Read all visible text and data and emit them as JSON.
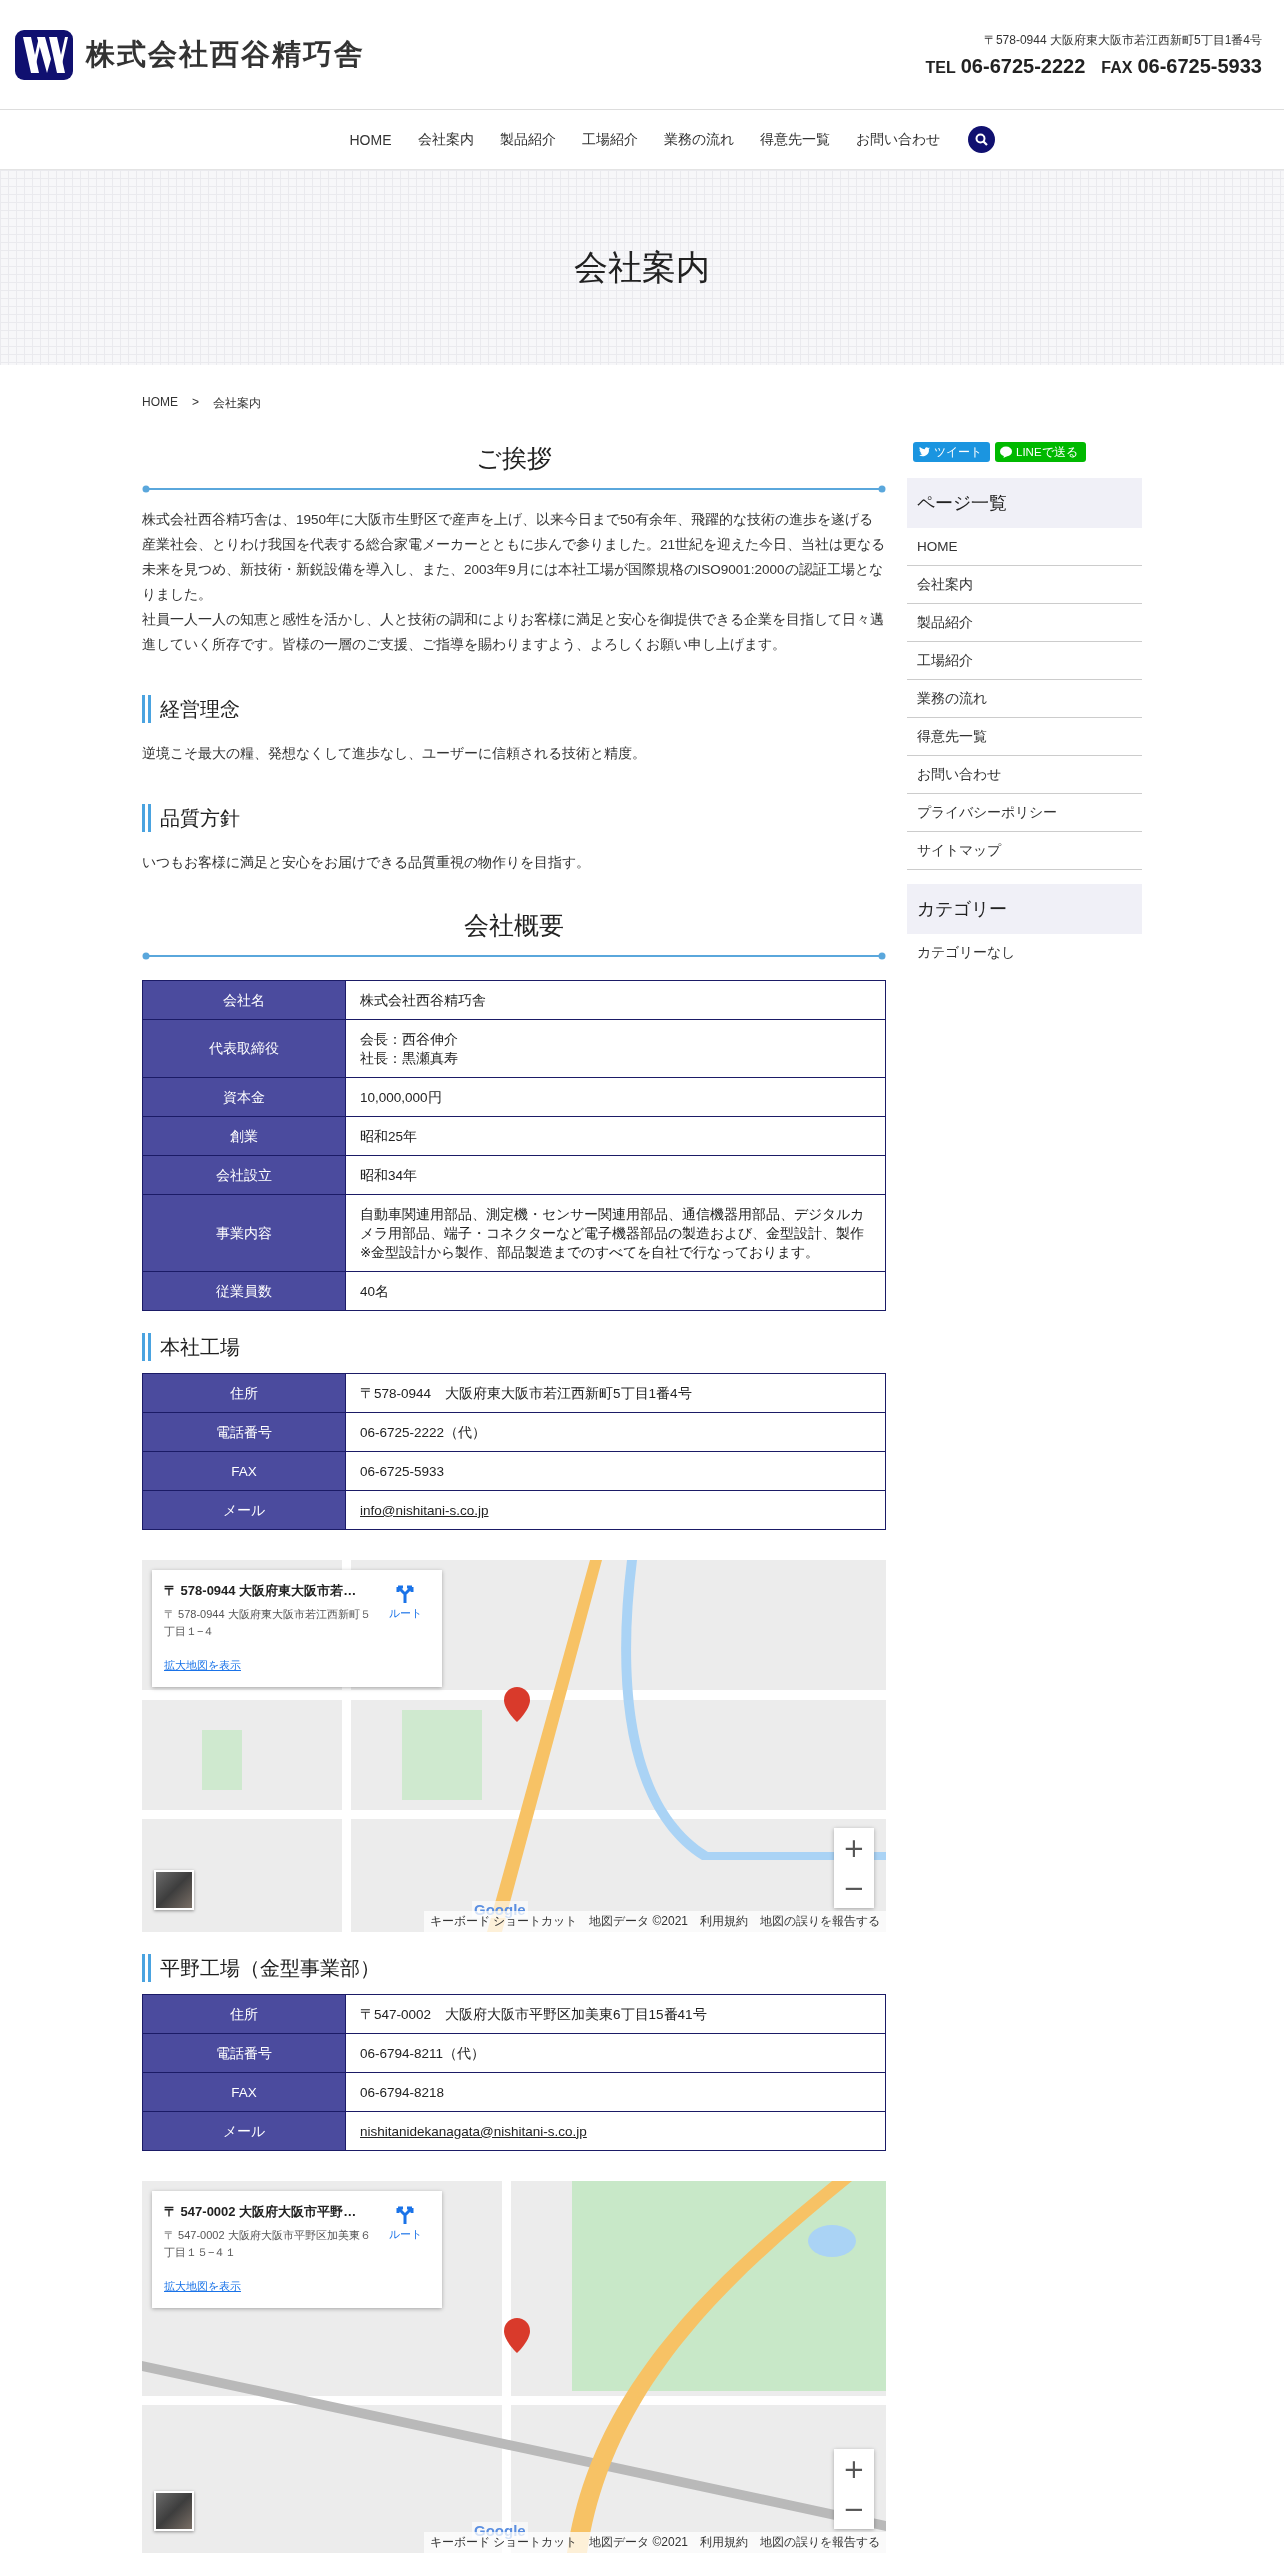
{
  "header": {
    "company_name": "株式会社西谷精巧舎",
    "address": "〒578-0944 大阪府東大阪市若江西新町5丁目1番4号",
    "tel_label": "TEL",
    "tel": "06-6725-2222",
    "fax_label": "FAX",
    "fax": "06-6725-5933"
  },
  "nav": [
    "HOME",
    "会社案内",
    "製品紹介",
    "工場紹介",
    "業務の流れ",
    "得意先一覧",
    "お問い合わせ"
  ],
  "hero_title": "会社案内",
  "breadcrumb": {
    "items": [
      "HOME",
      "会社案内"
    ],
    "separator": ">"
  },
  "main": [
    {
      "kind": "heading",
      "text": "ご挨拶"
    },
    {
      "kind": "text",
      "paragraphs": [
        "株式会社西谷精巧舎は、1950年に大阪市生野区で産声を上げ、以来今日まで50有余年、飛躍的な技術の進歩を遂げる産業社会、とりわけ我国を代表する総合家電メーカーとともに歩んで参りました。21世紀を迎えた今日、当社は更なる未来を見つめ、新技術・新鋭設備を導入し、また、2003年9月には本社工場が国際規格のISO9001:2000の認証工場となりました。",
        "社員一人一人の知恵と感性を活かし、人と技術の調和によりお客様に満足と安心を御提供できる企業を目指して日々邁進していく所存です。皆様の一層のご支援、ご指導を賜わりますよう、よろしくお願い申し上げます。"
      ]
    },
    {
      "kind": "subheading",
      "text": "経営理念"
    },
    {
      "kind": "text",
      "paragraphs": [
        "逆境こそ最大の糧、発想なくして進歩なし、ユーザーに信頼される技術と精度。"
      ]
    },
    {
      "kind": "subheading",
      "text": "品質方針"
    },
    {
      "kind": "text",
      "paragraphs": [
        "いつもお客様に満足と安心をお届けできる品質重視の物作りを目指す。"
      ]
    },
    {
      "kind": "heading",
      "text": "会社概要"
    },
    {
      "kind": "table",
      "rows": [
        {
          "label": "会社名",
          "value": "株式会社西谷精巧舎",
          "kind": "text"
        },
        {
          "label": "代表取締役",
          "value": "会長：西谷伸介",
          "value_2": "社長：黒瀬真寿",
          "kind": "text"
        },
        {
          "label": "資本金",
          "value": "10,000,000円",
          "kind": "text"
        },
        {
          "label": "創業",
          "value": "昭和25年",
          "kind": "text"
        },
        {
          "label": "会社設立",
          "value": "昭和34年",
          "kind": "text"
        },
        {
          "label": "事業内容",
          "value": "自動車関連用部品、測定機・センサー関連用部品、通信機器用部品、デジタルカメラ用部品、端子・コネクターなど電子機器部品の製造および、金型設計、製作",
          "value_2": "※金型設計から製作、部品製造までのすべてを自社で行なっております。",
          "kind": "text"
        },
        {
          "label": "従業員数",
          "value": "40名",
          "kind": "text"
        }
      ]
    },
    {
      "kind": "subheading",
      "text": "本社工場"
    },
    {
      "kind": "table",
      "rows": [
        {
          "label": "住所",
          "value": "〒578-0944　大阪府東大阪市若江西新町5丁目1番4号",
          "kind": "text"
        },
        {
          "label": "電話番号",
          "value": "06-6725-2222（代）",
          "kind": "text"
        },
        {
          "label": "FAX",
          "value": "06-6725-5933",
          "kind": "text"
        },
        {
          "label": "メール",
          "value": "info@nishitani-s.co.jp",
          "kind": "email"
        }
      ]
    },
    {
      "kind": "map",
      "card": {
        "title": "〒 578-0944 大阪府東大阪市若…",
        "address": "〒 578-0944 大阪府東大阪市若江西新町５丁目１−４",
        "route": "ルート",
        "link": "拡大地図を表示"
      },
      "zoom_in": "+",
      "zoom_out": "−",
      "logo": "Google",
      "attribution": [
        "キーボード ショートカット",
        "地図データ ©2021",
        "利用規約",
        "地図の誤りを報告する"
      ]
    },
    {
      "kind": "subheading",
      "text": "平野工場（金型事業部）"
    },
    {
      "kind": "table",
      "rows": [
        {
          "label": "住所",
          "value": "〒547-0002　大阪府大阪市平野区加美東6丁目15番41号",
          "kind": "text"
        },
        {
          "label": "電話番号",
          "value": "06-6794-8211（代）",
          "kind": "text"
        },
        {
          "label": "FAX",
          "value": "06-6794-8218",
          "kind": "text"
        },
        {
          "label": "メール",
          "value": "nishitanidekanagata@nishitani-s.co.jp",
          "kind": "email"
        }
      ]
    },
    {
      "kind": "map",
      "card": {
        "title": "〒 547-0002 大阪府大阪市平野…",
        "address": "〒 547-0002 大阪府大阪市平野区加美東６丁目１５−４１",
        "route": "ルート",
        "link": "拡大地図を表示"
      },
      "zoom_in": "+",
      "zoom_out": "−",
      "logo": "Google",
      "attribution": [
        "キーボード ショートカット",
        "地図データ ©2021",
        "利用規約",
        "地図の誤りを報告する"
      ]
    }
  ],
  "sidebar": {
    "share_buttons": [
      {
        "kind": "twitter",
        "label": "ツイート"
      },
      {
        "kind": "line",
        "label": "LINEで送る"
      }
    ],
    "widgets": [
      {
        "title": "ページ一覧",
        "divided": true,
        "items": [
          "HOME",
          "会社案内",
          "製品紹介",
          "工場紹介",
          "業務の流れ",
          "得意先一覧",
          "お問い合わせ",
          "プライバシーポリシー",
          "サイトマップ"
        ]
      },
      {
        "title": "カテゴリー",
        "divided": false,
        "items": [
          "カテゴリーなし"
        ]
      }
    ]
  }
}
